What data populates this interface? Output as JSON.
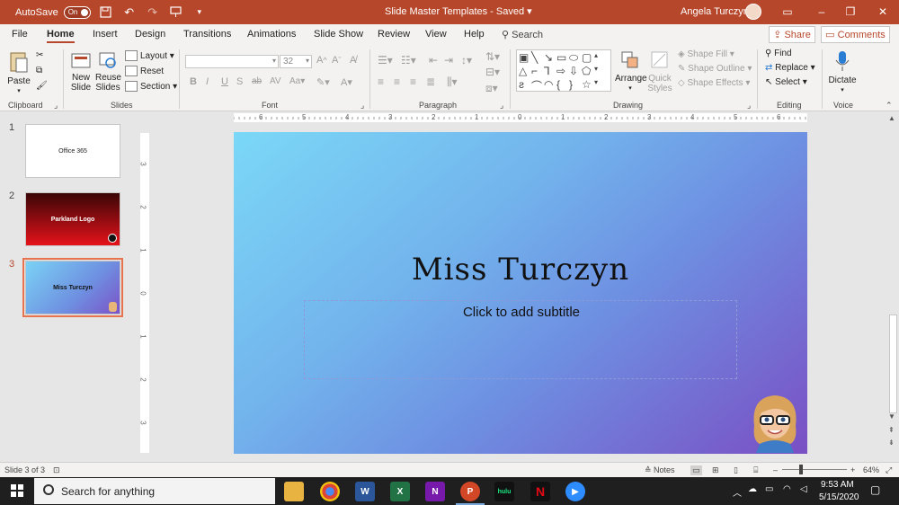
{
  "titlebar": {
    "autosave_label": "AutoSave",
    "autosave_state": "On",
    "document_title": "Slide Master Templates  -  Saved",
    "user": "Angela Turczyn"
  },
  "tabs": [
    "File",
    "Home",
    "Insert",
    "Design",
    "Transitions",
    "Animations",
    "Slide Show",
    "Review",
    "View",
    "Help"
  ],
  "active_tab": "Home",
  "search_label": "Search",
  "share_label": "Share",
  "comments_label": "Comments",
  "ribbon": {
    "clipboard": {
      "label": "Clipboard",
      "paste": "Paste"
    },
    "slides": {
      "label": "Slides",
      "new_slide": "New Slide",
      "reuse_slides": "Reuse Slides",
      "layout": "Layout",
      "reset": "Reset",
      "section": "Section"
    },
    "font": {
      "label": "Font",
      "size": "32"
    },
    "paragraph": {
      "label": "Paragraph"
    },
    "drawing": {
      "label": "Drawing",
      "arrange": "Arrange",
      "quick_styles": "Quick Styles",
      "shape_fill": "Shape Fill",
      "shape_outline": "Shape Outline",
      "shape_effects": "Shape Effects"
    },
    "editing": {
      "label": "Editing",
      "find": "Find",
      "replace": "Replace",
      "select": "Select"
    },
    "voice": {
      "label": "Voice",
      "dictate": "Dictate"
    }
  },
  "thumbnails": [
    {
      "number": "1",
      "text": "Office 365"
    },
    {
      "number": "2",
      "text": "Parkland Logo"
    },
    {
      "number": "3",
      "text": "Miss Turczyn"
    }
  ],
  "active_slide": 3,
  "slide": {
    "title": "Miss Turczyn",
    "subtitle_placeholder": "Click to add subtitle"
  },
  "rulers": {
    "horizontal": [
      "6",
      "5",
      "4",
      "3",
      "2",
      "1",
      "0",
      "1",
      "2",
      "3",
      "4",
      "5",
      "6"
    ],
    "vertical": [
      "3",
      "2",
      "1",
      "0",
      "1",
      "2",
      "3"
    ]
  },
  "statusbar": {
    "slide_info": "Slide 3 of 3",
    "notes": "Notes",
    "zoom": "64%"
  },
  "taskbar": {
    "search_placeholder": "Search for anything",
    "time": "9:53 AM",
    "date": "5/15/2020"
  },
  "colors": {
    "accent": "#b7472a",
    "slide_gradient_start": "#7bd8f7",
    "slide_gradient_end": "#7a4fc4"
  }
}
